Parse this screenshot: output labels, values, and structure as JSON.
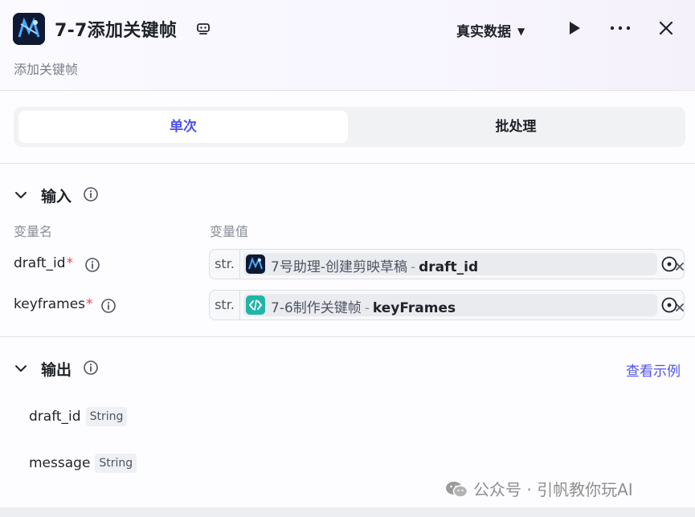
{
  "header": {
    "title": "7-7添加关键帧",
    "subtitle": "添加关键帧",
    "data_mode": "真实数据",
    "icons": {
      "logo": "node-logo-icon",
      "title_action": "copilot-icon",
      "run": "play-icon",
      "more": "more-icon",
      "close": "close-icon"
    }
  },
  "tabs": [
    {
      "label": "单次",
      "active": true
    },
    {
      "label": "批处理",
      "active": false
    }
  ],
  "input": {
    "title": "输入",
    "col_name": "变量名",
    "col_value": "变量值",
    "rows": [
      {
        "name": "draft_id",
        "required": "*",
        "type": "str.",
        "source": "7号助理-创建剪映草稿",
        "sep": "-",
        "var": "draft_id",
        "icon": "plugin-icon"
      },
      {
        "name": "keyframes",
        "required": "*",
        "type": "str.",
        "source": "7-6制作关键帧",
        "sep": "-",
        "var": "keyFrames",
        "icon": "code-icon"
      }
    ]
  },
  "output": {
    "title": "输出",
    "example_link": "查看示例",
    "fields": [
      {
        "name": "draft_id",
        "type": "String"
      },
      {
        "name": "message",
        "type": "String"
      }
    ]
  },
  "watermark": {
    "text": "公众号 · 引帆教你玩AI",
    "icon": "wechat-icon"
  },
  "colors": {
    "accent": "#4d53e8",
    "required": "#e5484d",
    "code_node": "#1fb5a8"
  }
}
